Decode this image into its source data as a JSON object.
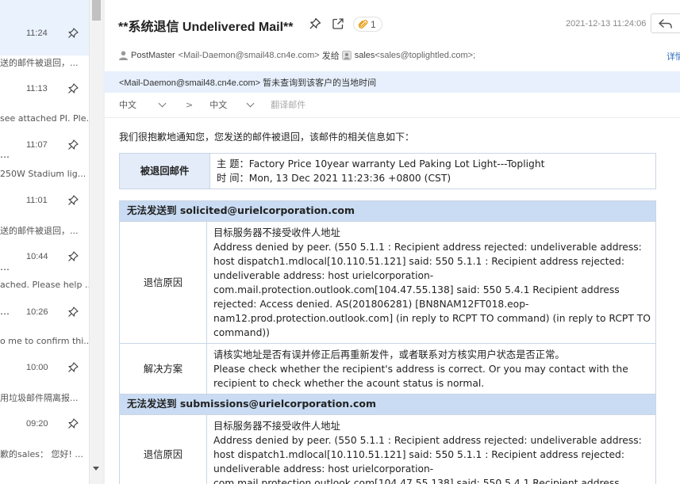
{
  "mail_list": {
    "items": [
      {
        "time": "11:24",
        "snippet": "送的邮件被退回，...",
        "active": true
      },
      {
        "time": "11:13",
        "snippet": "see attached PI. Ple...",
        "active": false
      },
      {
        "time": "11:07",
        "snippet": "250W Stadium lig...",
        "active": false
      },
      {
        "time": "11:01",
        "snippet": "送的邮件被退回，...",
        "active": false
      },
      {
        "time": "10:44",
        "snippet": "ached. Please help ...",
        "active": false
      },
      {
        "time": "10:26",
        "snippet": "o me to confirm thi...",
        "active": false
      },
      {
        "time": "10:00",
        "snippet": "用垃圾邮件隔离报...",
        "active": false
      },
      {
        "time": "09:20",
        "snippet": "歉的sales： 您好! ...",
        "active": false
      }
    ]
  },
  "email": {
    "subject": "**系统退信 Undelivered Mail**",
    "attachment_count": "1",
    "datetime": "2021-12-13 11:24:06",
    "sender_name": "PostMaster",
    "sender_address": "<Mail-Daemon@smail48.cn4e.com>",
    "sent_to_label": "发给",
    "recipient_name": "sales",
    "recipient_address": "<sales@toplightled.com>;",
    "details_link": "详情",
    "notice": "<Mail-Daemon@smail48.cn4e.com> 暂未查询到该客户的当地时间",
    "translate": {
      "source_lang": "中文",
      "arrow": ">",
      "target_lang": "中文",
      "translate_label": "翻译邮件"
    },
    "intro": "我们很抱歉地通知您，您发送的邮件被退回，该邮件的相关信息如下："
  },
  "bounced_mail": {
    "label": "被退回邮件",
    "subject_line": "主 题：Factory Price 10year warranty Led Paking Lot Light---Toplight",
    "time_line": "时 间：Mon, 13 Dec 2021 11:23:36 +0800 (CST)"
  },
  "failures": [
    {
      "heading": "无法发送到 solicited@urielcorporation.com",
      "reason_label": "退信原因",
      "reason_title": "目标服务器不接受收件人地址",
      "reason_detail": "Address denied by peer. (550 5.1.1 : Recipient address rejected: undeliverable address: host dispatch1.mdlocal[10.110.51.121] said: 550 5.1.1 : Recipient address rejected: undeliverable address: host urielcorporation-com.mail.protection.outlook.com[104.47.55.138] said: 550 5.4.1 Recipient address rejected: Access denied. AS(201806281) [BN8NAM12FT018.eop-nam12.prod.protection.outlook.com] (in reply to RCPT TO command) (in reply to RCPT TO command))",
      "solution_label": "解决方案",
      "solution_cn": "请核实地址是否有误并修正后再重新发件，或者联系对方核实用户状态是否正常。",
      "solution_en": "Please check whether the recipient's address is correct. Or you may contact with the recipient to check whether the acount status is normal."
    },
    {
      "heading": "无法发送到 submissions@urielcorporation.com",
      "reason_label": "退信原因",
      "reason_title": "目标服务器不接受收件人地址",
      "reason_detail": "Address denied by peer. (550 5.1.1 : Recipient address rejected: undeliverable address: host dispatch1.mdlocal[10.110.51.121] said: 550 5.1.1 : Recipient address rejected: undeliverable address: host urielcorporation-com.mail.protection.outlook.com[104.47.55.138] said: 550 5.4.1 Recipient address"
    }
  ],
  "colors": {
    "accent": "#2e6cb8",
    "active_row": "#e9f2fd",
    "notice_bg": "#e7f0fc",
    "table_head": "#c9dcf3",
    "table_label": "#e3ecf8"
  }
}
